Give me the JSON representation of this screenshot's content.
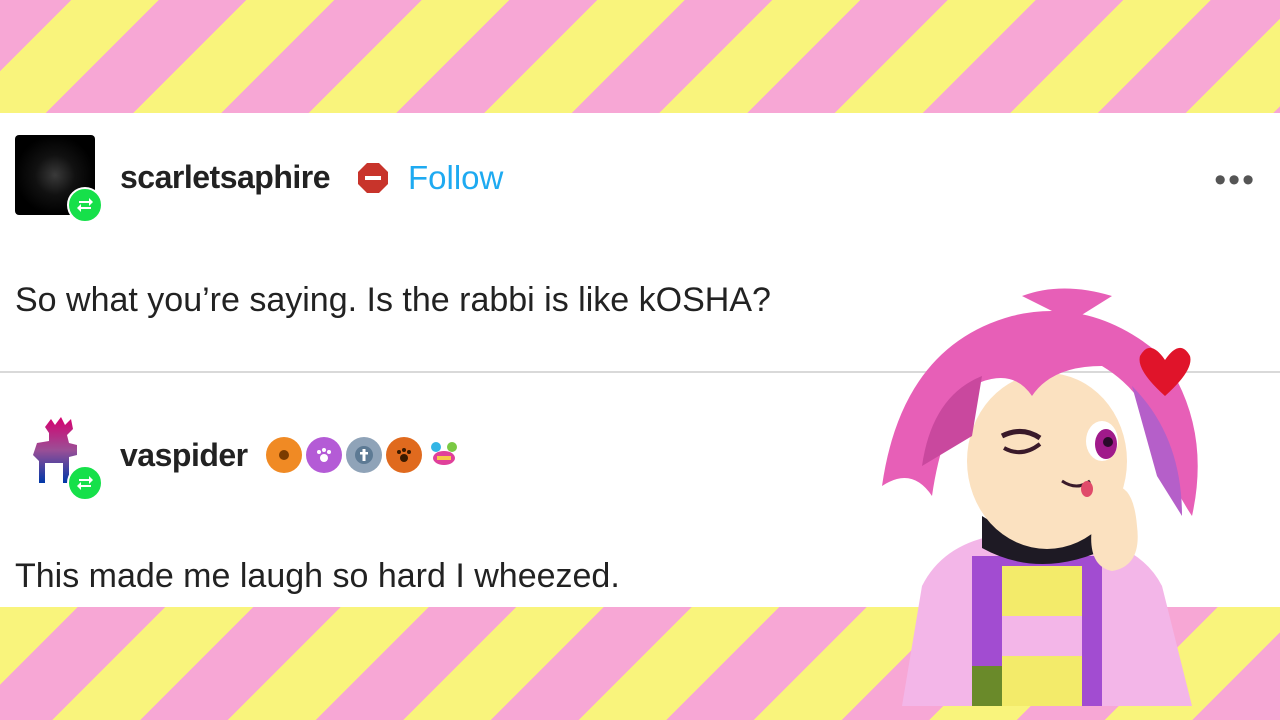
{
  "posts": [
    {
      "username": "scarletsaphire",
      "action": "Follow",
      "text": "So what you’re saying. Is the rabbi is like kOSHA?"
    },
    {
      "username": "vaspider",
      "text": "This made me laugh so hard I wheezed."
    }
  ],
  "icons": {
    "more_menu": "more-options-icon",
    "reblog": "reblog-icon",
    "badges_post2": [
      "sun-badge-icon",
      "paw-purple-badge-icon",
      "tumblr-badge-icon",
      "paw-orange-badge-icon",
      "crab-badge-icon"
    ]
  },
  "colors": {
    "stripe_pink": "#f7a7d5",
    "stripe_yellow": "#f9f47c",
    "follow_blue": "#1eaaf1",
    "reblog_green": "#16e04a"
  }
}
